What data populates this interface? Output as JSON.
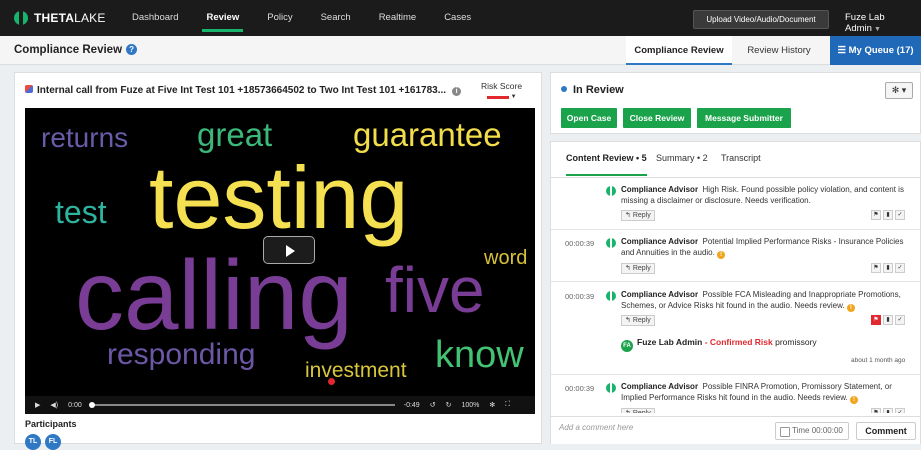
{
  "topbar": {
    "logo": {
      "bold": "THETA",
      "light": "LAKE"
    },
    "nav": [
      "Dashboard",
      "Review",
      "Policy",
      "Search",
      "Realtime",
      "Cases"
    ],
    "active_nav": "Review",
    "upload_label": "Upload Video/Audio/Document",
    "user": "Fuze Lab Admin"
  },
  "subheader": {
    "title": "Compliance Review",
    "tabs": {
      "compliance_review": "Compliance Review",
      "review_history": "Review History"
    },
    "queue_label": "My Queue (17)"
  },
  "call": {
    "title": "Internal call from Fuze at Five Int Test 101 +18573664502 to Two Int Test 101 +161783...",
    "risk_label": "Risk Score",
    "words": [
      "returns",
      "great",
      "guarantee",
      "test",
      "testing",
      "calling",
      "five",
      "word",
      "responding",
      "investment",
      "know"
    ],
    "controls": {
      "current": "0:00",
      "remaining": "-0:49",
      "speed": "100%"
    },
    "participants_label": "Participants",
    "participants": [
      "TL",
      "FL"
    ]
  },
  "review": {
    "status": "In Review",
    "actions": [
      "Open Case",
      "Close Review",
      "Message Submitter"
    ],
    "tabs": [
      "Content Review • 5",
      "Summary • 2",
      "Transcript"
    ],
    "reply_label": "Reply",
    "comments": [
      {
        "time": "",
        "author": "Compliance Advisor",
        "text": "High Risk. Found possible policy violation, and content is missing a disclaimer or disclosure. Needs verification.",
        "warn": false
      },
      {
        "time": "00:00:39",
        "author": "Compliance Advisor",
        "text": "Potential Implied Performance Risks - Insurance Policies and Annuities in the audio.",
        "warn": true
      },
      {
        "time": "00:00:39",
        "author": "Compliance Advisor",
        "text": "Possible FCA Misleading and Inappropriate Promotions, Schemes, or Advice Risks hit found in the audio. Needs review.",
        "warn": true
      },
      {
        "time": "00:00:39",
        "author": "Compliance Advisor",
        "text": "Possible FINRA Promotion, Promissory Statement, or Implied Performance Risks hit found in the audio. Needs review.",
        "warn": true
      }
    ],
    "confirmation": {
      "initials": "FA",
      "user": "Fuze Lab Admin",
      "status": "- Confirmed Risk",
      "note": "promissory",
      "ago": "about 1 month ago"
    },
    "comment_placeholder": "Add a comment here",
    "time_label": "Time 00:00:00",
    "comment_button": "Comment"
  },
  "colors": {
    "accent": "#18b46b",
    "blue": "#1f69b8",
    "risk": "#e0282e"
  }
}
